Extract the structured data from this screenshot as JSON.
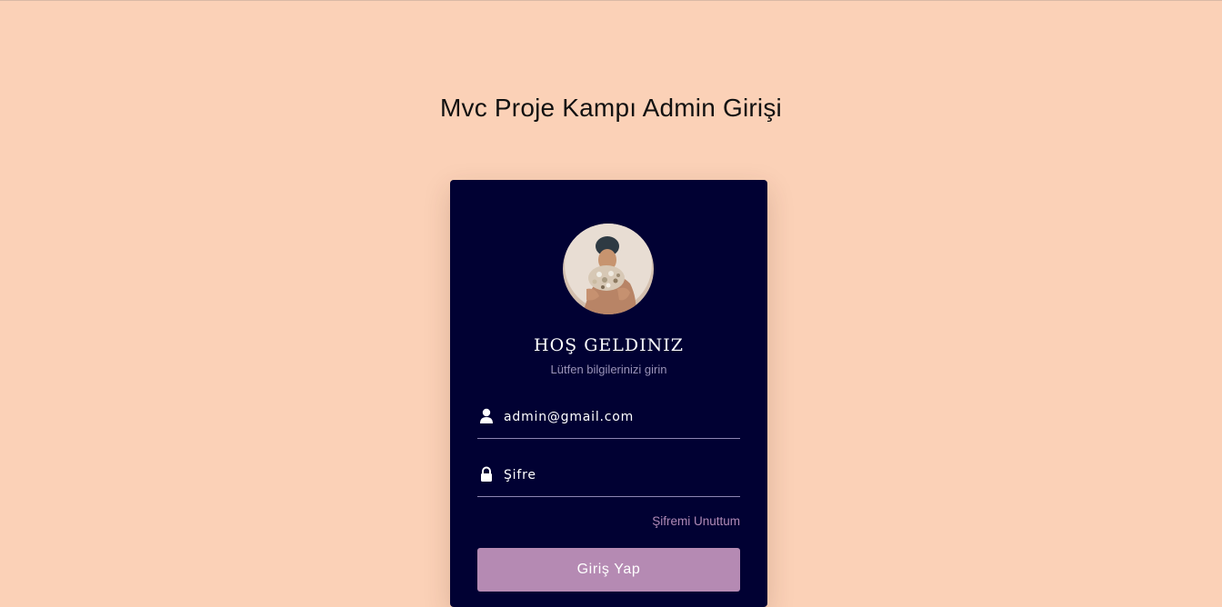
{
  "page": {
    "title": "Mvc Proje Kampı Admin Girişi"
  },
  "login_card": {
    "welcome_title": "HOŞ GELDINIZ",
    "welcome_subtitle": "Lütfen bilgilerinizi girin",
    "email_field": {
      "value": "admin@gmail.com",
      "icon": "user-icon"
    },
    "password_field": {
      "placeholder": "Şifre",
      "icon": "lock-icon"
    },
    "forgot_link": "Şifremi Unuttum",
    "login_button": "Giriş Yap"
  },
  "colors": {
    "background": "#fbd1b7",
    "card": "#010133",
    "accent": "#b58ab3",
    "link": "#b08ab6",
    "subtitle": "#9a93b7"
  }
}
